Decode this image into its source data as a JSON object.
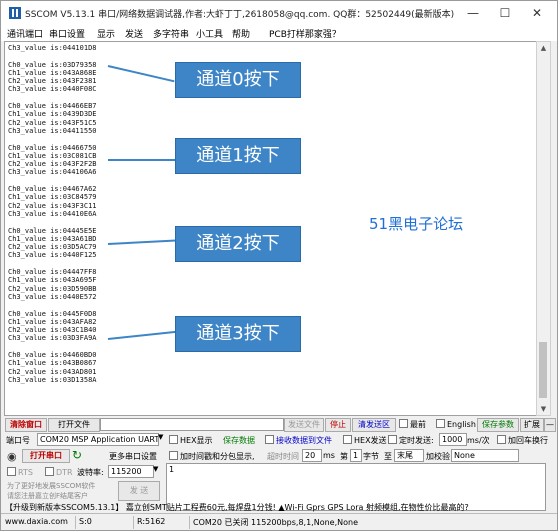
{
  "window": {
    "title": "SSCOM V5.13.1 串口/网络数据调试器,作者:大虾丁丁,2618058@qq.com. QQ群：52502449(最新版本)",
    "controls": [
      "—",
      "☐",
      "✕"
    ]
  },
  "menu": [
    "通讯端口",
    "串口设置",
    "显示",
    "发送",
    "多字符串",
    "小工具",
    "帮助",
    "PCB打样那家强？"
  ],
  "log": {
    "lines": [
      "Ch3_value is:044101D8",
      "",
      "Ch0_value is:03D79358",
      "Ch1_value is:043A868E",
      "Ch2_value is:043F2381",
      "Ch3_value is:0440F08C",
      "",
      "Ch0_value is:04466EB7",
      "Ch1_value is:0439D3DE",
      "Ch2_value is:043F51C5",
      "Ch3_value is:04411550",
      "",
      "Ch0_value is:04466750",
      "Ch1_value is:03C081CB",
      "Ch2_value is:043F2F2B",
      "Ch3_value is:044106A6",
      "",
      "Ch0_value is:04467A62",
      "Ch1_value is:03C84579",
      "Ch2_value is:043F3C11",
      "Ch3_value is:04410E6A",
      "",
      "Ch0_value is:04445E5E",
      "Ch1_value is:043A61BD",
      "Ch2_value is:03D5AC79",
      "Ch3_value is:0440F125",
      "",
      "Ch0_value is:04447FF8",
      "Ch1_value is:043A695F",
      "Ch2_value is:03D590BB",
      "Ch3_value is:0440E572",
      "",
      "Ch0_value is:0445F0D8",
      "Ch1_value is:043AFA82",
      "Ch2_value is:043C1B40",
      "Ch3_value is:03D3FA9A",
      "",
      "Ch0_value is:04460BD0",
      "Ch1_value is:043B0867",
      "Ch2_value is:043AD801",
      "Ch3_value is:03D1358A"
    ]
  },
  "annotations": {
    "ch0": "通道0按下",
    "ch1": "通道1按下",
    "ch2": "通道2按下",
    "ch3": "通道3按下",
    "watermark": "51黑电子论坛"
  },
  "toolbar": {
    "clear_window": "清除窗口",
    "open_file": "打开文件",
    "send_file": "发送文件",
    "stop": "停止",
    "clear_send": "清发送区",
    "topmost": "最前",
    "english": "English",
    "save_params": "保存参数",
    "expand": "扩展",
    "collapse": "—"
  },
  "row2": {
    "port_label": "端口号",
    "port_value": "COM20 MSP Application UART ",
    "hex_display": "HEX显示",
    "save_data": "保存数据",
    "receive_to_file": "接收数据到文件",
    "hex_send": "HEX发送",
    "timed_send": "定时发送:",
    "interval": "1000",
    "interval_unit": "ms/次",
    "add_cr_lf": "加回车换行"
  },
  "row3": {
    "open_port": "打开串口",
    "more_settings": "更多串口设置",
    "add_timestamp": "加时间戳和分包显示,",
    "timeout_label": "超时时间",
    "timeout": "20",
    "timeout_unit": "ms",
    "byte_no_prefix": "第",
    "byte_no": "1",
    "byte_label": "字节",
    "to": "至",
    "end": "末尾",
    "checksum_label": "加校验",
    "checksum": "None"
  },
  "row4": {
    "rts": "RTS",
    "dtr": "DTR",
    "baud_label": "波特率:",
    "baud": "115200",
    "send_text": "1"
  },
  "promo": {
    "line1": "为了更好地发展SSCOM软件",
    "line2": "请您注册嘉立创F结尾客户",
    "send": "发 送"
  },
  "ad": "【升级到新版本SSCOM5.13.1】  嘉立创SMT贴片工程费60元,每焊盘1分钱! ▲Wi-Fi Gprs GPS Lora 射频模组,在物性价比最高的?",
  "status": {
    "site": "www.daxia.com",
    "s": "S:0",
    "r": "R:5162",
    "port": "COM20 已关闭  115200bps,8,1,None,None"
  }
}
